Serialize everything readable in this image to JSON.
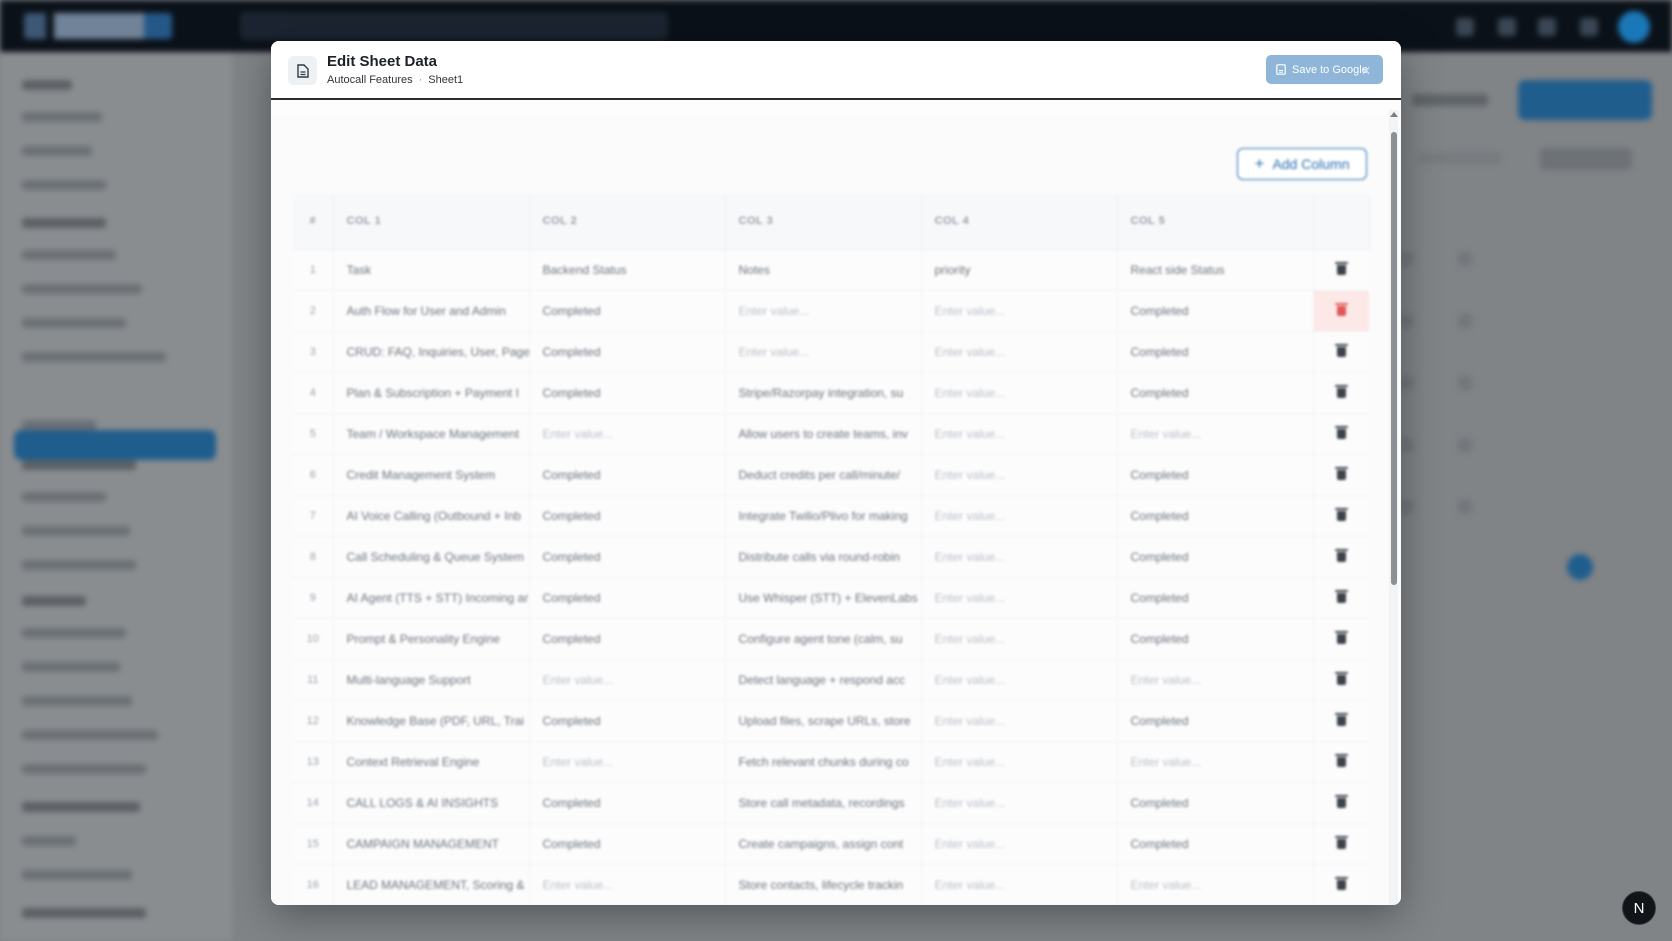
{
  "modal": {
    "title": "Edit Sheet Data",
    "spreadsheet_name": "Autocall Features",
    "sheet_name": "Sheet1",
    "save_label": "Save to Google",
    "add_column_label": "Add Column"
  },
  "table": {
    "headers": [
      "#",
      "COL 1",
      "COL 2",
      "COL 3",
      "COL 4",
      "COL 5"
    ],
    "placeholder": "Enter value...",
    "rows": [
      {
        "n": "1",
        "c1": "Task",
        "c2": "Backend Status",
        "c3": "Notes",
        "c4": "priority",
        "c5": "React side Status"
      },
      {
        "n": "2",
        "c1": "Auth Flow for User and Admin",
        "c2": "Completed",
        "c3": "",
        "c4": "",
        "c5": "Completed"
      },
      {
        "n": "3",
        "c1": "CRUD: FAQ, Inquiries, User, Page",
        "c2": "Completed",
        "c3": "",
        "c4": "",
        "c5": "Completed"
      },
      {
        "n": "4",
        "c1": "Plan & Subscription + Payment I",
        "c2": "Completed",
        "c3": "Stripe/Razorpay integration, su",
        "c4": "",
        "c5": "Completed"
      },
      {
        "n": "5",
        "c1": "Team / Workspace Management",
        "c2": "",
        "c3": "Allow users to create teams, inv",
        "c4": "",
        "c5": ""
      },
      {
        "n": "6",
        "c1": "Credit Management System",
        "c2": "Completed",
        "c3": "Deduct credits per call/minute/",
        "c4": "",
        "c5": "Completed"
      },
      {
        "n": "7",
        "c1": "AI Voice Calling (Outbound + Inb",
        "c2": "Completed",
        "c3": "Integrate Twilio/Plivo for making",
        "c4": "",
        "c5": "Completed"
      },
      {
        "n": "8",
        "c1": "Call Scheduling & Queue System",
        "c2": "Completed",
        "c3": "Distribute calls via round-robin",
        "c4": "",
        "c5": "Completed"
      },
      {
        "n": "9",
        "c1": "AI Agent (TTS + STT) Incoming ar",
        "c2": "Completed",
        "c3": "Use Whisper (STT) + ElevenLabs",
        "c4": "",
        "c5": "Completed"
      },
      {
        "n": "10",
        "c1": "Prompt & Personality Engine",
        "c2": "Completed",
        "c3": "Configure agent tone (calm, su",
        "c4": "",
        "c5": "Completed"
      },
      {
        "n": "11",
        "c1": "Multi-language Support",
        "c2": "",
        "c3": "Detect language + respond acc",
        "c4": "",
        "c5": ""
      },
      {
        "n": "12",
        "c1": "Knowledge Base (PDF, URL, Trai",
        "c2": "Completed",
        "c3": "Upload files, scrape URLs, store",
        "c4": "",
        "c5": "Completed"
      },
      {
        "n": "13",
        "c1": "Context Retrieval Engine",
        "c2": "",
        "c3": "Fetch relevant chunks during co",
        "c4": "",
        "c5": ""
      },
      {
        "n": "14",
        "c1": "CALL LOGS & AI INSIGHTS",
        "c2": "Completed",
        "c3": "Store call metadata, recordings",
        "c4": "",
        "c5": "Completed"
      },
      {
        "n": "15",
        "c1": "CAMPAIGN MANAGEMENT",
        "c2": "Completed",
        "c3": "Create campaigns, assign cont",
        "c4": "",
        "c5": "Completed"
      },
      {
        "n": "16",
        "c1": "LEAD MANAGEMENT, Scoring &",
        "c2": "",
        "c3": "Store contacts, lifecycle trackin",
        "c4": "",
        "c5": ""
      }
    ]
  },
  "badge": {
    "label": "N"
  },
  "colors": {
    "accent": "#2a6fae",
    "delete_highlight": "#e15656"
  }
}
